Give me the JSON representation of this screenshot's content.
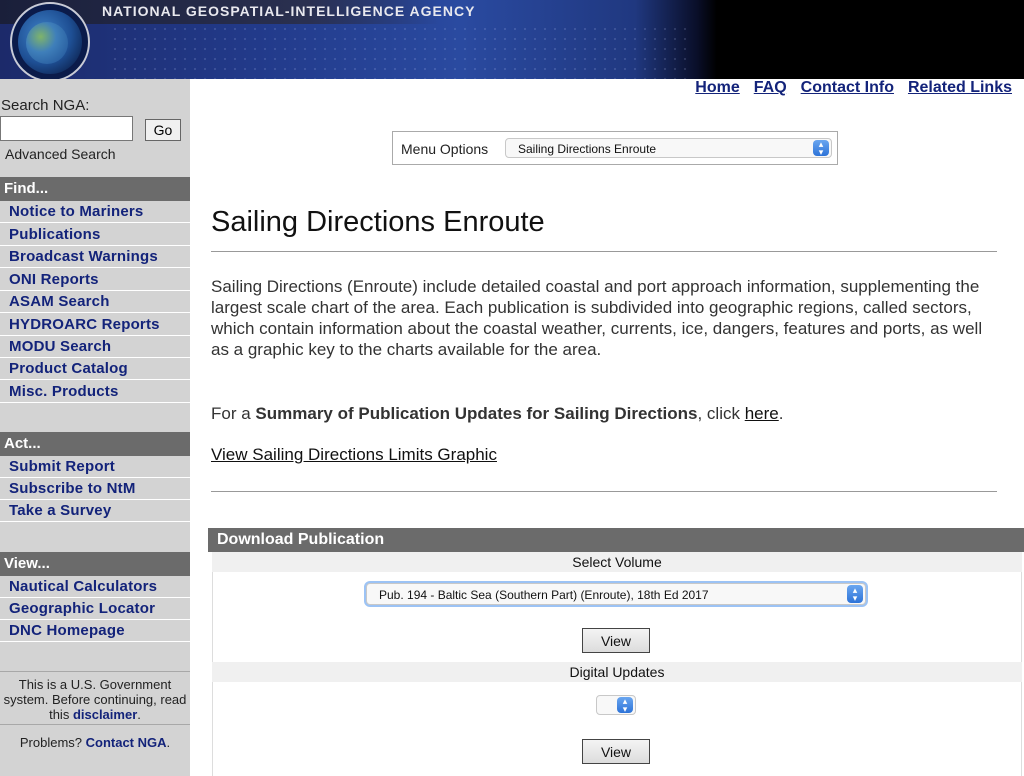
{
  "header": {
    "agency": "NATIONAL GEOSPATIAL-INTELLIGENCE AGENCY"
  },
  "top_links": [
    "Home",
    "FAQ",
    "Contact Info",
    "Related Links"
  ],
  "search": {
    "label": "Search NGA:",
    "value": "",
    "go_label": "Go",
    "advanced": "Advanced Search"
  },
  "sidebar": {
    "find_title": "Find...",
    "find_items": [
      "Notice to Mariners",
      "Publications",
      "Broadcast Warnings",
      "ONI Reports",
      "ASAM Search",
      "HYDROARC Reports",
      "MODU Search",
      "Product Catalog",
      "Misc. Products"
    ],
    "act_title": "Act...",
    "act_items": [
      "Submit Report",
      "Subscribe to NtM",
      "Take a Survey"
    ],
    "view_title": "View...",
    "view_items": [
      "Nautical Calculators",
      "Geographic Locator",
      "DNC Homepage"
    ],
    "disclaimer_1": "This is a U.S. Government",
    "disclaimer_2": "system.  Before continuing, read",
    "disclaimer_3": "this ",
    "disclaimer_link": "disclaimer",
    "disclaimer_end": ".",
    "problems": "Problems? ",
    "problems_link": "Contact NGA",
    "problems_end": "."
  },
  "menu_options": {
    "label": "Menu Options",
    "selected": "Sailing Directions Enroute"
  },
  "main": {
    "title": "Sailing Directions Enroute",
    "description": "Sailing Directions (Enroute) include detailed coastal and port approach information, supplementing the largest scale chart of the area. Each publication is subdivided into geographic regions, called sectors, which contain information about the coastal weather, currents, ice, dangers, features and ports, as well as a graphic key to the charts available for the area.",
    "summary_prefix": "For a ",
    "summary_bold": "Summary of Publication Updates for Sailing Directions",
    "summary_mid": ", click ",
    "summary_link": "here",
    "summary_end": ".",
    "limits_link": "View Sailing Directions Limits Graphic"
  },
  "download": {
    "title": "Download Publication",
    "select_volume_label": "Select Volume",
    "volume_selected": "Pub. 194 - Baltic Sea (Southern Part) (Enroute), 18th Ed 2017",
    "view_label": "View",
    "digital_updates_label": "Digital Updates",
    "digital_selected": "",
    "view_label_2": "View"
  }
}
